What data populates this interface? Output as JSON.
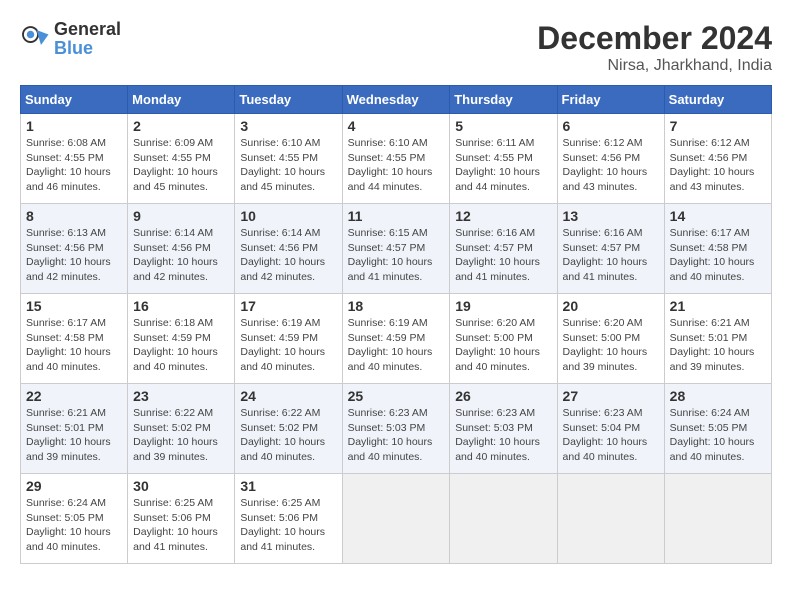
{
  "header": {
    "logo_general": "General",
    "logo_blue": "Blue",
    "month_title": "December 2024",
    "location": "Nirsa, Jharkhand, India"
  },
  "calendar": {
    "days_of_week": [
      "Sunday",
      "Monday",
      "Tuesday",
      "Wednesday",
      "Thursday",
      "Friday",
      "Saturday"
    ],
    "weeks": [
      [
        null,
        {
          "day": 2,
          "sunrise": "6:09 AM",
          "sunset": "4:55 PM",
          "daylight": "10 hours and 45 minutes."
        },
        {
          "day": 3,
          "sunrise": "6:10 AM",
          "sunset": "4:55 PM",
          "daylight": "10 hours and 45 minutes."
        },
        {
          "day": 4,
          "sunrise": "6:10 AM",
          "sunset": "4:55 PM",
          "daylight": "10 hours and 44 minutes."
        },
        {
          "day": 5,
          "sunrise": "6:11 AM",
          "sunset": "4:55 PM",
          "daylight": "10 hours and 44 minutes."
        },
        {
          "day": 6,
          "sunrise": "6:12 AM",
          "sunset": "4:56 PM",
          "daylight": "10 hours and 43 minutes."
        },
        {
          "day": 7,
          "sunrise": "6:12 AM",
          "sunset": "4:56 PM",
          "daylight": "10 hours and 43 minutes."
        }
      ],
      [
        {
          "day": 1,
          "sunrise": "6:08 AM",
          "sunset": "4:55 PM",
          "daylight": "10 hours and 46 minutes."
        },
        {
          "day": 8,
          "sunrise": "6:13 AM",
          "sunset": "4:56 PM",
          "daylight": "10 hours and 42 minutes."
        },
        {
          "day": 9,
          "sunrise": "6:14 AM",
          "sunset": "4:56 PM",
          "daylight": "10 hours and 42 minutes."
        },
        {
          "day": 10,
          "sunrise": "6:14 AM",
          "sunset": "4:56 PM",
          "daylight": "10 hours and 42 minutes."
        },
        {
          "day": 11,
          "sunrise": "6:15 AM",
          "sunset": "4:57 PM",
          "daylight": "10 hours and 41 minutes."
        },
        {
          "day": 12,
          "sunrise": "6:16 AM",
          "sunset": "4:57 PM",
          "daylight": "10 hours and 41 minutes."
        },
        {
          "day": 13,
          "sunrise": "6:16 AM",
          "sunset": "4:57 PM",
          "daylight": "10 hours and 41 minutes."
        },
        {
          "day": 14,
          "sunrise": "6:17 AM",
          "sunset": "4:58 PM",
          "daylight": "10 hours and 40 minutes."
        }
      ],
      [
        {
          "day": 15,
          "sunrise": "6:17 AM",
          "sunset": "4:58 PM",
          "daylight": "10 hours and 40 minutes."
        },
        {
          "day": 16,
          "sunrise": "6:18 AM",
          "sunset": "4:59 PM",
          "daylight": "10 hours and 40 minutes."
        },
        {
          "day": 17,
          "sunrise": "6:19 AM",
          "sunset": "4:59 PM",
          "daylight": "10 hours and 40 minutes."
        },
        {
          "day": 18,
          "sunrise": "6:19 AM",
          "sunset": "4:59 PM",
          "daylight": "10 hours and 40 minutes."
        },
        {
          "day": 19,
          "sunrise": "6:20 AM",
          "sunset": "5:00 PM",
          "daylight": "10 hours and 40 minutes."
        },
        {
          "day": 20,
          "sunrise": "6:20 AM",
          "sunset": "5:00 PM",
          "daylight": "10 hours and 39 minutes."
        },
        {
          "day": 21,
          "sunrise": "6:21 AM",
          "sunset": "5:01 PM",
          "daylight": "10 hours and 39 minutes."
        }
      ],
      [
        {
          "day": 22,
          "sunrise": "6:21 AM",
          "sunset": "5:01 PM",
          "daylight": "10 hours and 39 minutes."
        },
        {
          "day": 23,
          "sunrise": "6:22 AM",
          "sunset": "5:02 PM",
          "daylight": "10 hours and 39 minutes."
        },
        {
          "day": 24,
          "sunrise": "6:22 AM",
          "sunset": "5:02 PM",
          "daylight": "10 hours and 40 minutes."
        },
        {
          "day": 25,
          "sunrise": "6:23 AM",
          "sunset": "5:03 PM",
          "daylight": "10 hours and 40 minutes."
        },
        {
          "day": 26,
          "sunrise": "6:23 AM",
          "sunset": "5:03 PM",
          "daylight": "10 hours and 40 minutes."
        },
        {
          "day": 27,
          "sunrise": "6:23 AM",
          "sunset": "5:04 PM",
          "daylight": "10 hours and 40 minutes."
        },
        {
          "day": 28,
          "sunrise": "6:24 AM",
          "sunset": "5:05 PM",
          "daylight": "10 hours and 40 minutes."
        }
      ],
      [
        {
          "day": 29,
          "sunrise": "6:24 AM",
          "sunset": "5:05 PM",
          "daylight": "10 hours and 40 minutes."
        },
        {
          "day": 30,
          "sunrise": "6:25 AM",
          "sunset": "5:06 PM",
          "daylight": "10 hours and 41 minutes."
        },
        {
          "day": 31,
          "sunrise": "6:25 AM",
          "sunset": "5:06 PM",
          "daylight": "10 hours and 41 minutes."
        },
        null,
        null,
        null,
        null
      ]
    ]
  }
}
